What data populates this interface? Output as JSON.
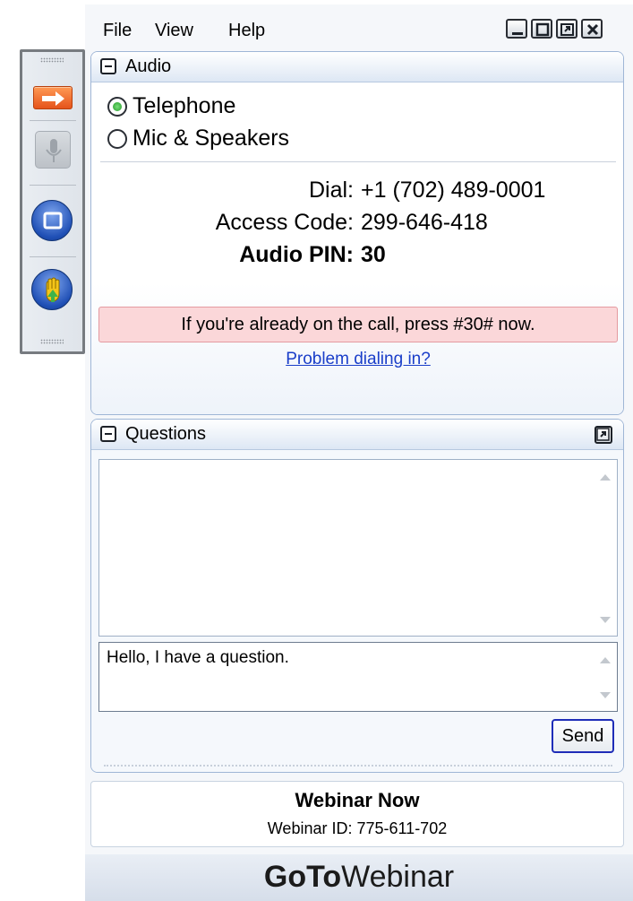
{
  "menu": {
    "file": "File",
    "view": "View",
    "help": "Help"
  },
  "audio": {
    "title": "Audio",
    "options": [
      {
        "label": "Telephone",
        "selected": true
      },
      {
        "label": "Mic & Speakers",
        "selected": false
      }
    ],
    "dial_label": "Dial:",
    "dial_value": "+1 (702) 489-0001",
    "access_label": "Access Code:",
    "access_value": "299-646-418",
    "pin_label": "Audio PIN:",
    "pin_value": "30",
    "notice": "If you're already on the call, press #30# now.",
    "problem_link": "Problem dialing in?"
  },
  "questions": {
    "title": "Questions",
    "input_value": "Hello, I have a question.",
    "send_label": "Send"
  },
  "webinar": {
    "name": "Webinar Now",
    "id_label": "Webinar ID: 775-611-702"
  },
  "brand": {
    "bold": "GoTo",
    "regular": "Webinar"
  },
  "colors": {
    "notice_bg": "#fbd7d9",
    "accent_orange": "#e5531b",
    "accent_blue": "#1f4fb5",
    "link": "#1a3ec9"
  },
  "icons": {
    "toolbar": [
      "show-panel-arrow-icon",
      "microphone-icon",
      "screen-share-icon",
      "raise-hand-icon"
    ],
    "window": [
      "minimize-icon",
      "maximize-icon",
      "restore-icon",
      "close-icon"
    ]
  }
}
